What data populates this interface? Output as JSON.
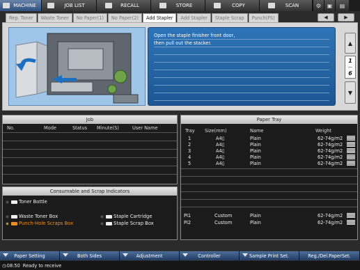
{
  "top_tabs": [
    {
      "label": "MACHINE",
      "icon": "machine-icon"
    },
    {
      "label": "JOB LIST",
      "icon": "job-list-icon"
    },
    {
      "label": "RECALL",
      "icon": "recall-icon"
    },
    {
      "label": "STORE",
      "icon": "store-icon"
    },
    {
      "label": "COPY",
      "icon": "copy-icon"
    },
    {
      "label": "SCAN",
      "icon": "scan-icon"
    }
  ],
  "error_tabs": [
    "Rep. Toner",
    "Waste Toner",
    "No Paper(1)",
    "No Paper(2)",
    "Add Stapler",
    "Add Stapler",
    "Staple Scrap",
    "Punch(FS)"
  ],
  "nav": {
    "prev": "◀",
    "next": "▶"
  },
  "message": {
    "line1": "Open the staple finisher front door,",
    "line2": "then pull out the stacker."
  },
  "page_indicator": {
    "current": "1",
    "total": "6"
  },
  "job": {
    "title": "Job",
    "columns": [
      "No.",
      "Mode",
      "Status",
      "Minute(S)",
      "User Name"
    ]
  },
  "paper_tray": {
    "title": "Paper Tray",
    "columns": [
      "Tray",
      "Size(mm)",
      "Name",
      "Weight"
    ],
    "rows": [
      {
        "tray": "1",
        "size": "A4▯",
        "name": "Plain",
        "weight": "62-74g/m2"
      },
      {
        "tray": "2",
        "size": "A4▯",
        "name": "Plain",
        "weight": "62-74g/m2"
      },
      {
        "tray": "3",
        "size": "A4▯",
        "name": "Plain",
        "weight": "62-74g/m2"
      },
      {
        "tray": "4",
        "size": "A4▯",
        "name": "Plain",
        "weight": "62-74g/m2"
      },
      {
        "tray": "5",
        "size": "A4▯",
        "name": "Plain",
        "weight": "62-74g/m2"
      }
    ],
    "pi_rows": [
      {
        "tray": "PI1",
        "size": "Custom",
        "name": "Plain",
        "weight": "62-74g/m2"
      },
      {
        "tray": "PI2",
        "size": "Custom",
        "name": "Plain",
        "weight": "62-74g/m2"
      }
    ]
  },
  "indicators": {
    "title": "Consumable and Scrap Indicators",
    "toner": "Toner Bottle",
    "waste": "Waste Toner Box",
    "punch": "Punch-Hole Scraps Box",
    "staple_cartridge": "Staple Cartridge",
    "staple_scrap": "Staple Scrap Box"
  },
  "bottom_buttons": [
    "Paper Setting",
    "Both Sides",
    "Adjustment",
    "Controller",
    "Sample Print Set.",
    "Reg./Del.PaperSet."
  ],
  "status": {
    "time": "08:50",
    "text": "Ready to receive"
  },
  "colors": {
    "accent": "#2e74b6",
    "warning": "#e9902a",
    "active_tab": "#3a5d8f"
  }
}
